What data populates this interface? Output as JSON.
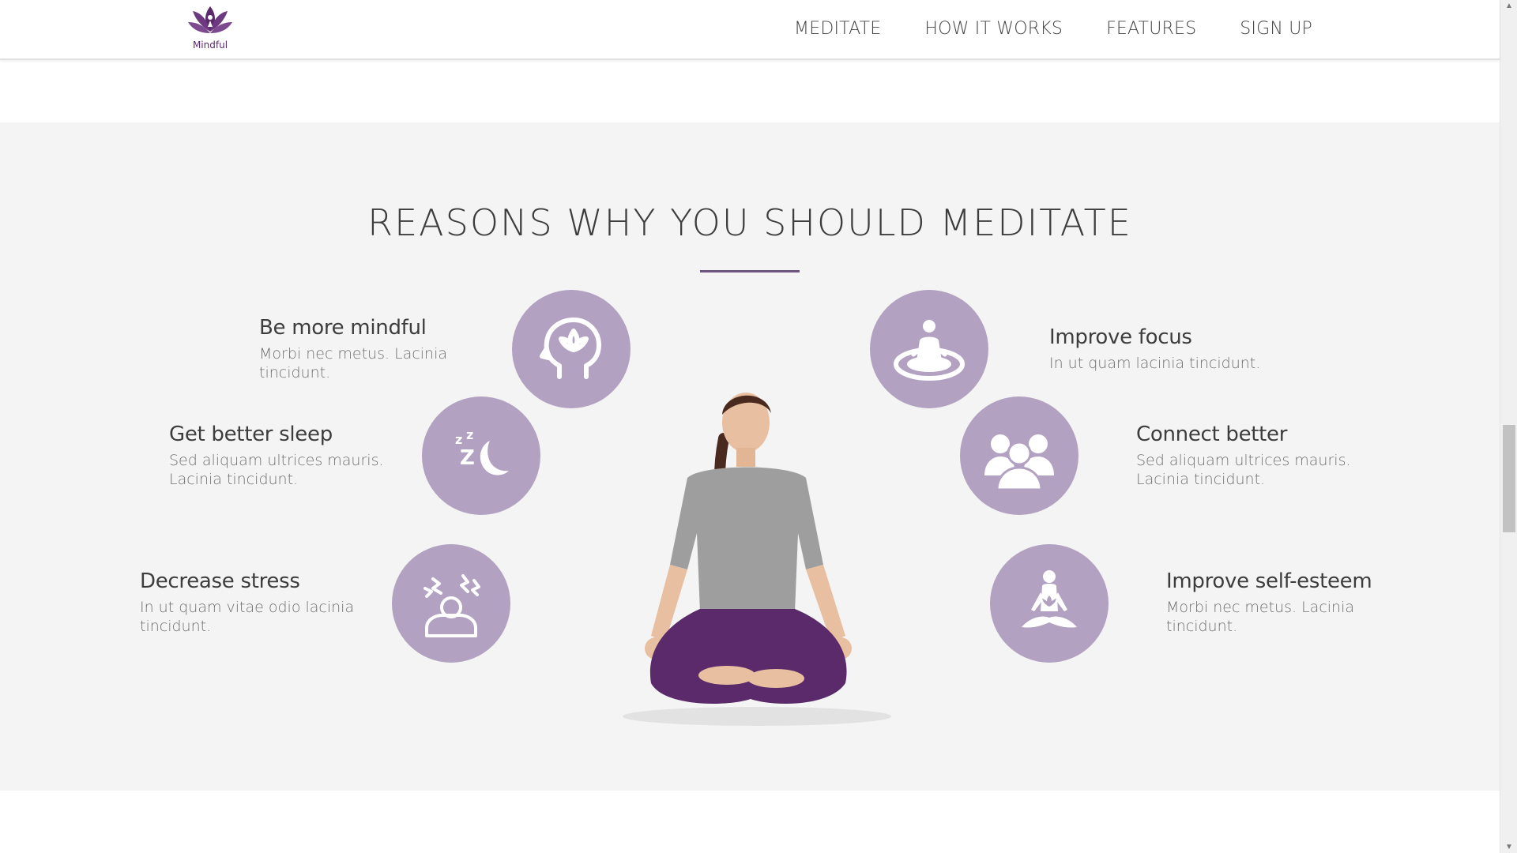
{
  "brand": {
    "name": "Mindful",
    "color": "#5b2a6b"
  },
  "nav": {
    "items": [
      "MEDITATE",
      "HOW IT WORKS",
      "FEATURES",
      "SIGN UP"
    ]
  },
  "section": {
    "title": "REASONS WHY YOU SHOULD MEDITATE",
    "accent_color": "#b2a1c1",
    "rule_color": "#6d5580"
  },
  "features": {
    "mindful": {
      "title": "Be more mindful",
      "text": "Morbi nec metus. Lacinia tincidunt.",
      "icon": "head-lotus-icon"
    },
    "sleep": {
      "title": "Get better sleep",
      "text": "Sed aliquam ultrices mauris. Lacinia tincidunt.",
      "icon": "moon-zzz-icon"
    },
    "stress": {
      "title": "Decrease stress",
      "text": "In ut quam vitae odio lacinia tincidunt.",
      "icon": "stressed-person-icon"
    },
    "focus": {
      "title": "Improve focus",
      "text": "In ut quam lacinia tincidunt.",
      "icon": "meditating-person-ring-icon"
    },
    "connect": {
      "title": "Connect better",
      "text": "Sed aliquam ultrices mauris. Lacinia tincidunt.",
      "icon": "group-people-icon"
    },
    "esteem": {
      "title": "Improve self-esteem",
      "text": "Morbi nec metus. Lacinia tincidunt.",
      "icon": "lotus-meditation-icon"
    }
  }
}
